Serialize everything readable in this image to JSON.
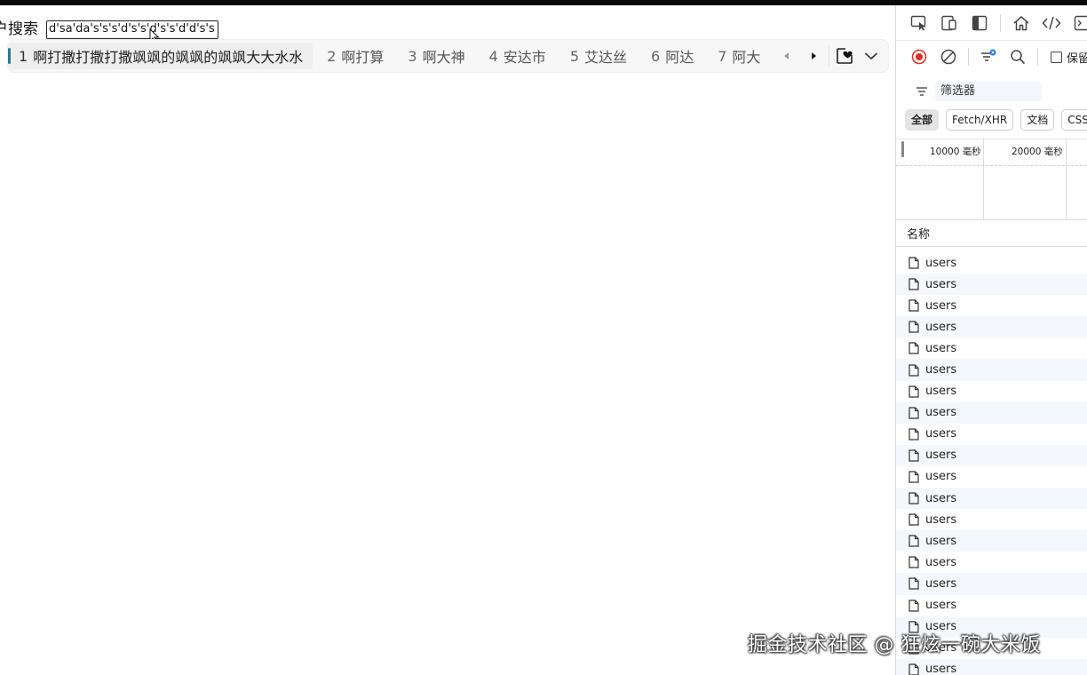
{
  "search": {
    "label": "户搜索",
    "value": "d'sa'da's's's'd's's'd's's'd'd's's"
  },
  "tabs": [
    {
      "index": "1",
      "label": "啊打撒打撒打撒飒飒的飒飒的飒飒大大水水",
      "active": true
    },
    {
      "index": "2",
      "label": "啊打算",
      "active": false
    },
    {
      "index": "3",
      "label": "啊大神",
      "active": false
    },
    {
      "index": "4",
      "label": "安达市",
      "active": false
    },
    {
      "index": "5",
      "label": "艾达丝",
      "active": false
    },
    {
      "index": "6",
      "label": "阿达",
      "active": false
    },
    {
      "index": "7",
      "label": "阿大",
      "active": false
    }
  ],
  "devtools": {
    "preserve_log_label": "保留",
    "filter_label": "筛选器",
    "type_filters": [
      {
        "label": "全部",
        "active": true
      },
      {
        "label": "Fetch/XHR",
        "active": false
      },
      {
        "label": "文档",
        "active": false
      },
      {
        "label": "CSS",
        "active": false
      }
    ],
    "timeline_labels": [
      "10000  毫秒",
      "20000  毫秒"
    ],
    "column_name": "名称",
    "requests": [
      "users",
      "users",
      "users",
      "users",
      "users",
      "users",
      "users",
      "users",
      "users",
      "users",
      "users",
      "users",
      "users",
      "users",
      "users",
      "users",
      "users",
      "users",
      "users",
      "users"
    ]
  },
  "watermark": "掘金技术社区 @ 狂炫一碗大米饭",
  "colors": {
    "active_tab_indicator": "#2c7a8c",
    "record_button": "#d93025",
    "clear_badge": "#1a73e8"
  }
}
